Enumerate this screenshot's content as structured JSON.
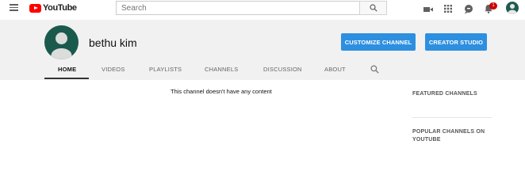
{
  "masthead": {
    "logo_text": "YouTube",
    "search_placeholder": "Search",
    "notification_count": "1",
    "icons": [
      "menu-icon",
      "youtube-logo",
      "search-icon",
      "create-video-icon",
      "apps-icon",
      "messages-icon",
      "notifications-icon",
      "account-avatar"
    ]
  },
  "channel": {
    "name": "bethu kim",
    "customize_label": "CUSTOMIZE CHANNEL",
    "studio_label": "CREATOR STUDIO",
    "accent_color": "#2d8fe0",
    "tabs": [
      {
        "label": "HOME",
        "active": true
      },
      {
        "label": "VIDEOS",
        "active": false
      },
      {
        "label": "PLAYLISTS",
        "active": false
      },
      {
        "label": "CHANNELS",
        "active": false
      },
      {
        "label": "DISCUSSION",
        "active": false
      },
      {
        "label": "ABOUT",
        "active": false
      }
    ]
  },
  "content": {
    "empty_message": "This channel doesn't have any content"
  },
  "sidebar": {
    "featured_title": "FEATURED CHANNELS",
    "popular_title": "POPULAR CHANNELS ON YOUTUBE"
  }
}
